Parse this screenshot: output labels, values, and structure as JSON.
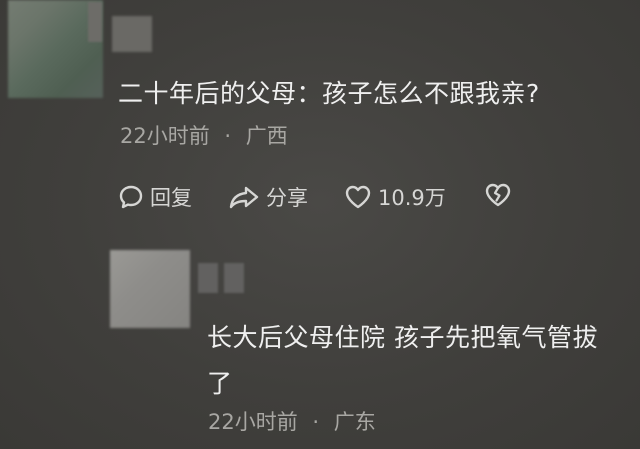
{
  "comment": {
    "text": "二十年后的父母：孩子怎么不跟我亲?",
    "time": "22小时前",
    "separator": "·",
    "location": "广西",
    "actions": {
      "reply_label": "回复",
      "share_label": "分享",
      "like_count": "10.9万"
    }
  },
  "reply": {
    "text_line1": "长大后父母住院 孩子先把氧气管拔",
    "text_line2": "了",
    "time": "22小时前",
    "separator": "·",
    "location": "广东"
  },
  "icons": {
    "reply": "speech-bubble-icon",
    "share": "share-arrow-icon",
    "like": "heart-icon",
    "dislike": "broken-heart-icon"
  }
}
